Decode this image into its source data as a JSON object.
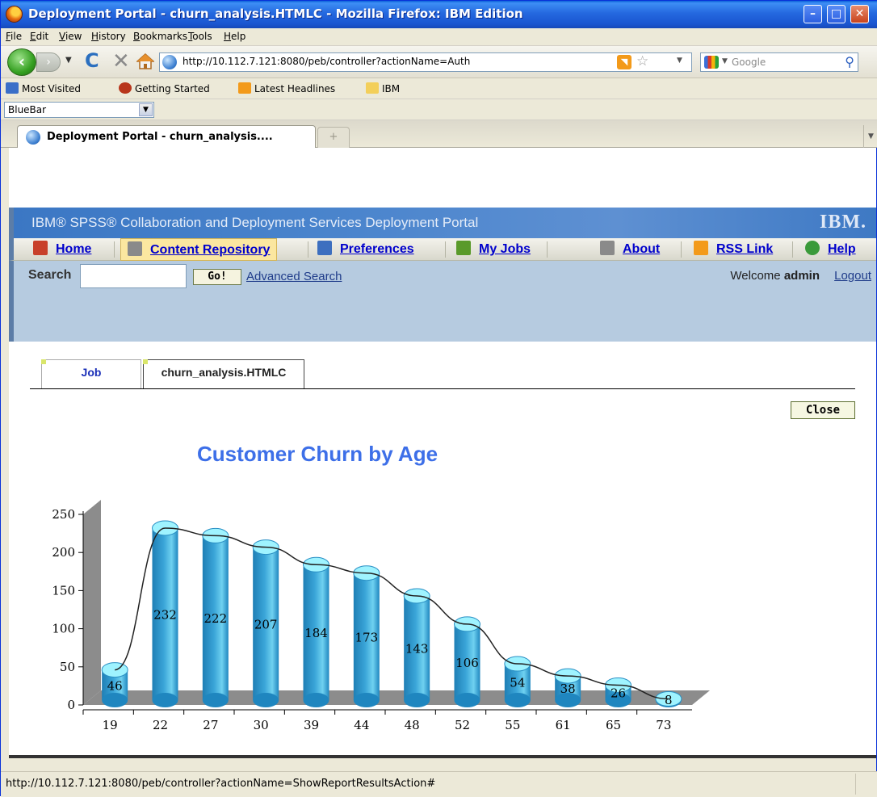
{
  "window": {
    "title": "Deployment Portal - churn_analysis.HTMLC - Mozilla Firefox: IBM Edition",
    "minimize_glyph": "–",
    "maximize_glyph": "□",
    "close_glyph": "✕"
  },
  "menu": [
    "File",
    "Edit",
    "View",
    "History",
    "Bookmarks",
    "Tools",
    "Help"
  ],
  "navbar": {
    "url": "http://10.112.7.121:8080/peb/controller?actionName=Auth",
    "search_placeholder": "Google",
    "icons": [
      "back-icon",
      "forward-icon",
      "reload-icon",
      "stop-icon",
      "home-icon",
      "rss-icon",
      "star-icon",
      "search-icon"
    ]
  },
  "bookmarks": [
    {
      "label": "Most Visited",
      "icon": "most-visited-icon",
      "color": "#3a6fc8"
    },
    {
      "label": "Getting Started",
      "icon": "firefox-icon",
      "color": "#b8361c"
    },
    {
      "label": "Latest Headlines",
      "icon": "rss-icon",
      "color": "#f39a1a"
    },
    {
      "label": "IBM",
      "icon": "folder-icon",
      "color": "#f3cf5a"
    }
  ],
  "bluebar": {
    "selected": "BlueBar"
  },
  "browser_tab": {
    "label": "Deployment Portal - churn_analysis...."
  },
  "portal": {
    "title": "IBM® SPSS® Collaboration and Deployment Services Deployment Portal",
    "logo": "IBM.",
    "nav": [
      {
        "label": "Home",
        "icon": "home-icon",
        "color": "#c8402a"
      },
      {
        "label": "Content Repository",
        "icon": "repository-icon",
        "color": "#8a8a8a"
      },
      {
        "label": "Preferences",
        "icon": "preferences-icon",
        "color": "#3d6fbf"
      },
      {
        "label": "My Jobs",
        "icon": "jobs-icon",
        "color": "#5a9a2a"
      },
      {
        "label": "About",
        "icon": "document-icon",
        "color": "#8a8a8a"
      },
      {
        "label": "RSS Link",
        "icon": "rss-icon",
        "color": "#f39a1a"
      },
      {
        "label": "Help",
        "icon": "help-icon",
        "color": "#3a9a3a"
      }
    ],
    "search_label": "Search",
    "go_label": "Go!",
    "advanced_search": "Advanced Search",
    "welcome_prefix": "Welcome ",
    "user": "admin",
    "logout": "Logout"
  },
  "report": {
    "tabs": [
      "Job",
      "churn_analysis.HTMLC"
    ],
    "close_label": "Close"
  },
  "chart_data": {
    "type": "bar",
    "title": "Customer Churn by Age",
    "xlabel": "",
    "ylabel": "",
    "categories": [
      "19",
      "22",
      "27",
      "30",
      "39",
      "44",
      "48",
      "52",
      "55",
      "61",
      "65",
      "73"
    ],
    "values": [
      46,
      232,
      222,
      207,
      184,
      173,
      143,
      106,
      54,
      38,
      26,
      8
    ],
    "ylim": [
      0,
      250
    ],
    "yticks": [
      0,
      50,
      100,
      150,
      200,
      250
    ],
    "trendline": true,
    "colors": {
      "bar": "#3aa5d8",
      "bar_top": "#9ff3ff",
      "floor": "#8c8c8c"
    }
  },
  "status": {
    "text": "http://10.112.7.121:8080/peb/controller?actionName=ShowReportResultsAction#"
  }
}
